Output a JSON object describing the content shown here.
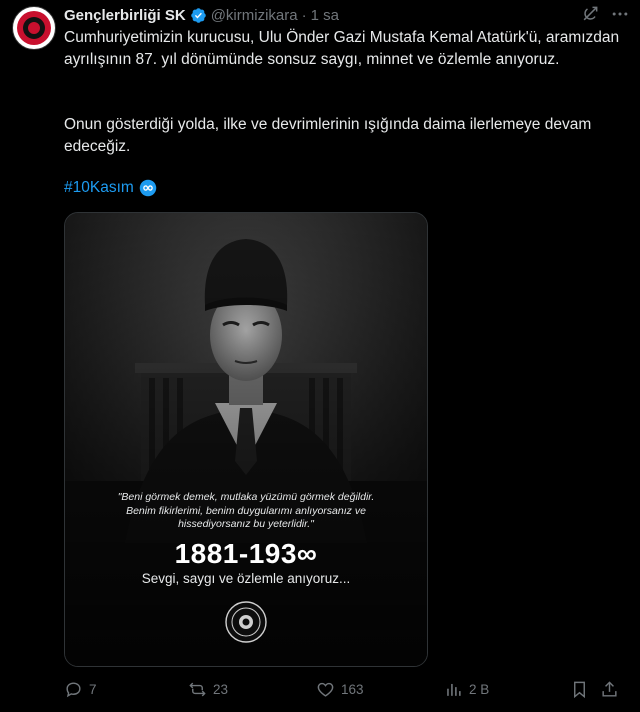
{
  "author": {
    "name": "Gençlerbirliği SK",
    "handle": "@kirmizikara",
    "separator": "·",
    "time": "1 sa"
  },
  "tweet": {
    "paragraph1": "Cumhuriyetimizin kurucusu, Ulu Önder Gazi Mustafa Kemal Atatürk'ü, aramızdan ayrılışının 87. yıl dönümünde sonsuz saygı, minnet ve özlemle anıyoruz.",
    "paragraph2": "Onun gösterdiği yolda, ilke ve devrimlerinin ışığında daima ilerlemeye devam edeceğiz.",
    "hashtag": "#10Kasım"
  },
  "media": {
    "quote": "\"Beni görmek demek, mutlaka yüzümü görmek değildir. Benim fikirlerimi, benim duygularımı anlıyorsanız ve hissediyorsanız bu yeterlidir.\"",
    "years": "1881-193∞",
    "subline": "Sevgi, saygı ve özlemle anıyoruz..."
  },
  "actions": {
    "replies": "7",
    "reposts": "23",
    "likes": "163",
    "views": "2 B"
  },
  "colors": {
    "background": "#000000",
    "accent": "#1d9bf0",
    "muted": "#71767b",
    "club_red": "#c8102e"
  }
}
